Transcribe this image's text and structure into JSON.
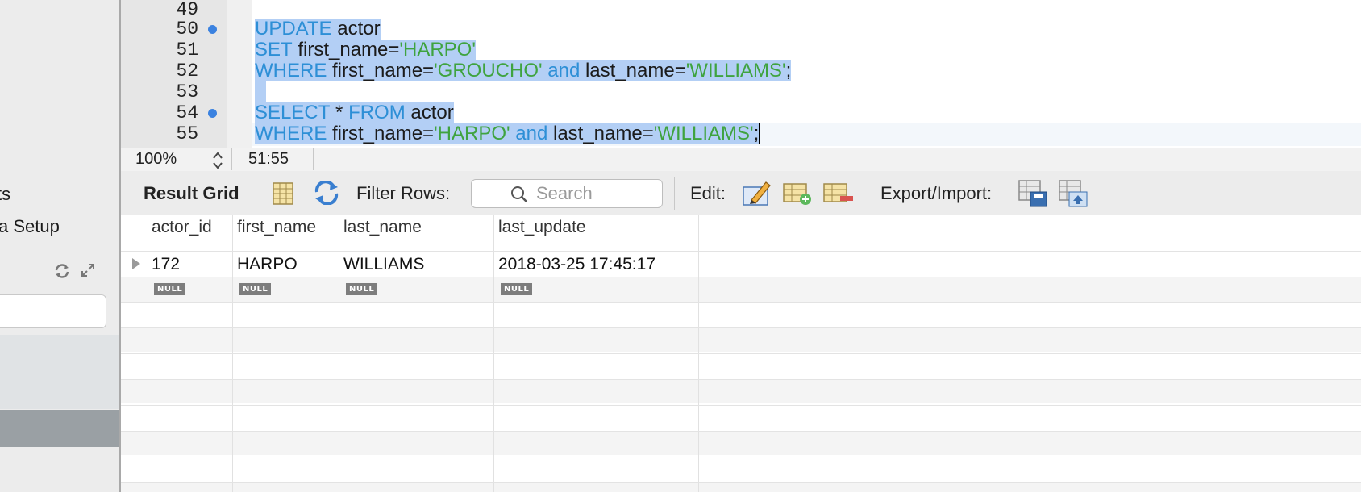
{
  "sidebar": {
    "item_partial_1": "ts",
    "item_partial_2": "a Setup",
    "refresh_icon": "refresh-icon",
    "expand_icon": "expand-icon"
  },
  "editor": {
    "line_numbers": [
      "49",
      "50",
      "51",
      "52",
      "53",
      "54",
      "55"
    ],
    "lines": [
      [],
      [
        {
          "t": "UPDATE",
          "c": "kw"
        },
        {
          "t": " actor",
          "c": "pl"
        }
      ],
      [
        {
          "t": "SET",
          "c": "kw"
        },
        {
          "t": " first_name=",
          "c": "pl"
        },
        {
          "t": "'HARPO'",
          "c": "str"
        }
      ],
      [
        {
          "t": "WHERE",
          "c": "kw"
        },
        {
          "t": " first_name=",
          "c": "pl"
        },
        {
          "t": "'GROUCHO'",
          "c": "str"
        },
        {
          "t": " and",
          "c": "kw"
        },
        {
          "t": " last_name=",
          "c": "pl"
        },
        {
          "t": "'WILLIAMS'",
          "c": "str"
        },
        {
          "t": ";",
          "c": "pl"
        }
      ],
      [],
      [
        {
          "t": "SELECT",
          "c": "kw"
        },
        {
          "t": " * ",
          "c": "pl"
        },
        {
          "t": "FROM",
          "c": "kw"
        },
        {
          "t": " actor",
          "c": "pl"
        }
      ],
      [
        {
          "t": "WHERE",
          "c": "kw"
        },
        {
          "t": " first_name=",
          "c": "pl"
        },
        {
          "t": "'HARPO'",
          "c": "str"
        },
        {
          "t": " and",
          "c": "kw"
        },
        {
          "t": " last_name=",
          "c": "pl"
        },
        {
          "t": "'WILLIAMS'",
          "c": "str"
        },
        {
          "t": ";",
          "c": "pl"
        }
      ]
    ],
    "colors": {
      "keyword": "#2d8fd6",
      "string": "#3fa33f",
      "selection": "#b3cff5",
      "breakpoint": "#3b82e0"
    }
  },
  "status": {
    "zoom": "100%",
    "cursor_position": "51:55"
  },
  "toolbar": {
    "result_grid_label": "Result Grid",
    "filter_rows_label": "Filter Rows:",
    "search_placeholder": "Search",
    "edit_label": "Edit:",
    "export_import_label": "Export/Import:"
  },
  "grid": {
    "columns": [
      "actor_id",
      "first_name",
      "last_name",
      "last_update"
    ],
    "rows": [
      [
        "172",
        "HARPO",
        "WILLIAMS",
        "2018-03-25 17:45:17"
      ]
    ],
    "new_row": [
      "NULL",
      "NULL",
      "NULL",
      "NULL"
    ]
  }
}
